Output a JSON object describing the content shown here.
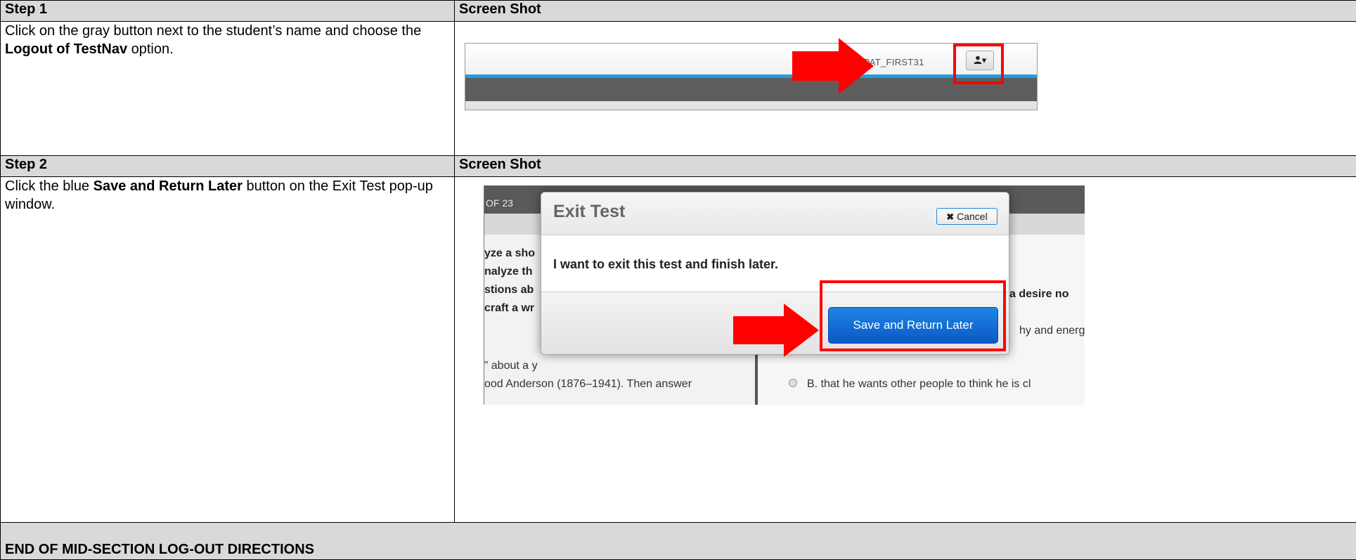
{
  "step1": {
    "header_left": "Step 1",
    "header_right": "Screen Shot",
    "instruction_before": "Click on the gray button next to the student’s name and choose the ",
    "instruction_bold": "Logout of TestNav",
    "instruction_after": " option.",
    "screenshot": {
      "username": "E. EPAT_FIRST31",
      "user_button_icon": "user-icon",
      "caret": "▾"
    }
  },
  "step2": {
    "header_left": "Step 2",
    "header_right": "Screen Shot",
    "instruction_before": "Click the blue ",
    "instruction_bold": "Save and Return Later",
    "instruction_after": " button on the Exit Test pop-up window.",
    "screenshot": {
      "header_text": "OF 23",
      "left_bold_lines": [
        "yze a sho",
        "nalyze th",
        "stions ab",
        "craft a wr"
      ],
      "left_text_lines": [
        "” about a y",
        "ood Anderson (1876–1941). Then answer"
      ],
      "right_bold_line": "a desire no",
      "right_text_line1": "hy and energ",
      "right_text_line2": "B.  that he wants other people to think he is cl",
      "modal": {
        "title": "Exit Test",
        "cancel_label": "Cancel",
        "cancel_icon": "✖",
        "message": "I want to exit this test and finish later.",
        "save_label": "Save and Return Later"
      }
    }
  },
  "footer": "END OF MID-SECTION LOG-OUT DIRECTIONS",
  "colors": {
    "header_bg": "#d9d9d9",
    "highlight_red": "#ff0000",
    "save_blue": "#1565d8",
    "accent_blue": "#1e9fe0"
  }
}
